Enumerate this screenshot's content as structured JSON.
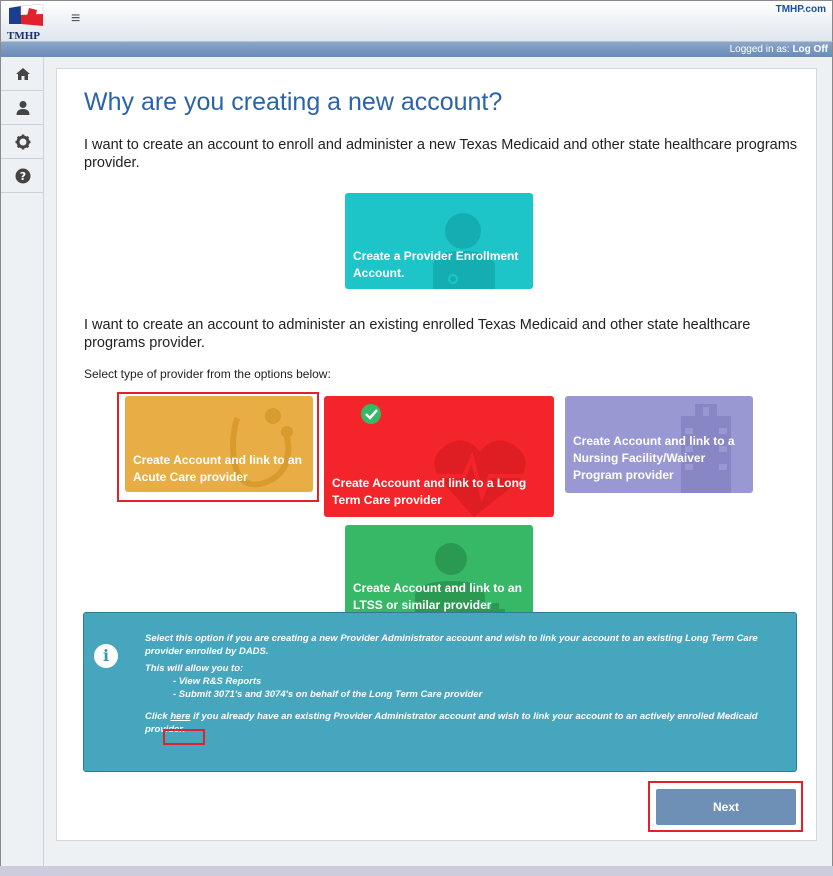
{
  "header": {
    "logo_text": "TMHP",
    "menu_icon": "hamburger-menu-icon",
    "site_link": "TMHP.com"
  },
  "statusbar": {
    "logged_in_label": "Logged in as:",
    "logoff_label": "Log Off"
  },
  "sidebar": {
    "items": [
      {
        "icon": "home-icon"
      },
      {
        "icon": "user-icon"
      },
      {
        "icon": "gear-icon"
      },
      {
        "icon": "help-icon"
      }
    ]
  },
  "page": {
    "title": "Why are you creating a new account?",
    "intro_new": "I want to create an account to enroll and administer a new Texas Medicaid and other state healthcare programs provider.",
    "intro_existing": "I want to create an account to administer an existing enrolled Texas Medicaid and other state healthcare programs provider.",
    "select_prompt": "Select type of provider from the options below:"
  },
  "tiles": {
    "enrollment": "Create a Provider Enrollment Account.",
    "acute": "Create Account and link to an Acute Care provider",
    "ltc": "Create Account and link to a Long Term Care provider",
    "nursing": "Create Account and link to a Nursing Facility/Waiver Program provider",
    "ltss": "Create Account and link to an LTSS or similar provider"
  },
  "info": {
    "icon": "info-icon",
    "line1": "Select this option if you are creating a new Provider Administrator account and wish to link your account to an existing Long Term Care provider enrolled by DADS.",
    "line2": "This will allow you to:",
    "bullet1": "- View R&S Reports",
    "bullet2": "- Submit 3071's and 3074's on behalf of the Long Term Care provider",
    "click_prefix": "Click ",
    "here_link": "here",
    "click_suffix": " if you already have an existing Provider Administrator account and wish to link your account to an actively enrolled Medicaid provider."
  },
  "actions": {
    "next_label": "Next"
  },
  "colors": {
    "enrollment": "#1dc4c8",
    "acute": "#e8ae45",
    "ltc": "#f4252a",
    "nursing": "#9a98d2",
    "ltss": "#37b866",
    "info_bg": "#45a6be",
    "title": "#2a64a8",
    "highlight": "#e0232a"
  }
}
